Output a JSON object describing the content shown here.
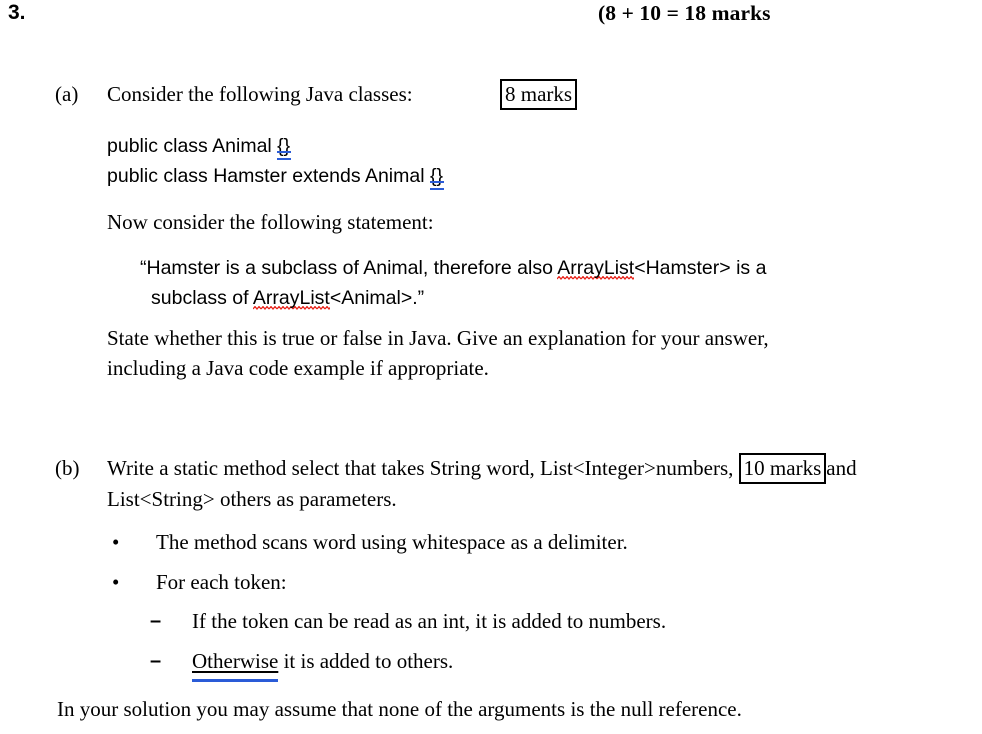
{
  "header": {
    "question_number": "3.",
    "marks_total": "(8 + 10 = 18 marks"
  },
  "parts": [
    {
      "label": "(a)",
      "prompt": "Consider the following Java classes:",
      "marks_box": "8 marks",
      "code_lines": [
        {
          "text": "public class Animal ",
          "braces": "{}"
        },
        {
          "text": "public class Hamster extends Animal ",
          "braces": "{}"
        }
      ],
      "lead_in": "Now consider the following statement:",
      "quote": {
        "line1_a": "“Hamster is a subclass of Animal, therefore also ",
        "line1_misspelled": "ArrayList",
        "line1_b": "<Hamster> is a",
        "line2_a": "subclass of ",
        "line2_misspelled": "ArrayList",
        "line2_b": "<Animal>.”"
      },
      "instruction_line1": "State whether this is true or false in Java. Give an explanation for your answer,",
      "instruction_line2": "including a Java code example if appropriate."
    },
    {
      "label": "(b)",
      "marks_box": "10 marks",
      "prompt_line1_a": "Write a static method select that takes String word, List<Integer>numbers, ",
      "prompt_line1_b": "and",
      "prompt_line2": "List<String> others as parameters.",
      "bullets": [
        {
          "marker": "•",
          "text": "The method scans word using whitespace as a delimiter."
        },
        {
          "marker": "•",
          "text": "For each token:"
        }
      ],
      "sub_bullets": [
        {
          "marker": "–",
          "text": "If the token can be read as an int, it is added to numbers.",
          "underlined": ""
        },
        {
          "marker": "–",
          "underlined": "Otherwise",
          "text": " it is added to others."
        }
      ],
      "closing": "In your solution you may assume that none of the arguments is the null reference."
    }
  ]
}
